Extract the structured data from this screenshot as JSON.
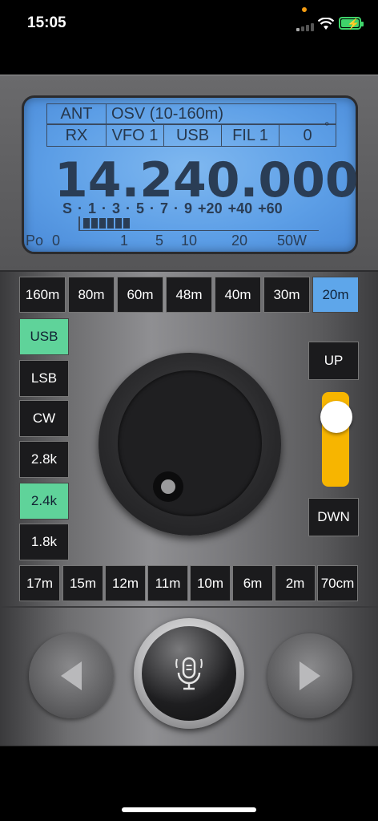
{
  "status_bar": {
    "time": "15:05"
  },
  "lcd": {
    "ant_label": "ANT",
    "ant_value": "OSV (10-160m)",
    "mode_row": [
      "RX",
      "VFO 1",
      "USB",
      "FIL 1",
      "0"
    ],
    "degree_mark": "°",
    "frequency": "14.240.000",
    "s_scale": "S · 1 · 3 · 5 · 7 · 9   +20  +40  +60",
    "s_meter_level": 0.22,
    "power_scale": [
      "Po",
      "0",
      "1",
      "5",
      "10",
      "20",
      "50W"
    ]
  },
  "bands_top": [
    "160m",
    "80m",
    "60m",
    "48m",
    "40m",
    "30m",
    "20m"
  ],
  "band_selected": "20m",
  "modes": [
    "USB",
    "LSB",
    "CW",
    "2.8k",
    "2.4k",
    "1.8k"
  ],
  "modes_selected": [
    "USB",
    "2.4k"
  ],
  "bands_bottom": [
    "17m",
    "15m",
    "12m",
    "11m",
    "10m",
    "6m",
    "2m",
    "70cm"
  ],
  "tuning": {
    "up_label": "UP",
    "down_label": "DWN",
    "slider_level": 0.85
  },
  "colors": {
    "lcd_blue": "#5c9ee6",
    "selected_green": "#5fd39a",
    "selected_blue": "#5ea6ea",
    "slider_yellow": "#f7b500"
  },
  "icons": [
    "previous-icon",
    "microphone-icon",
    "next-icon"
  ]
}
